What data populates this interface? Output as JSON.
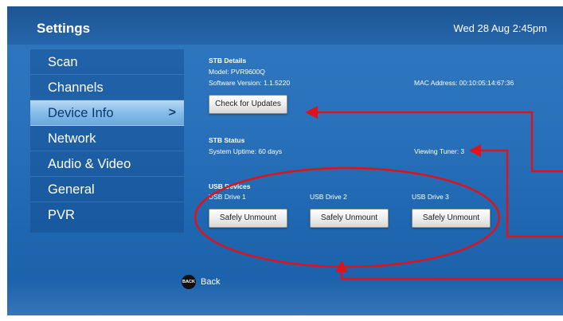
{
  "header": {
    "title": "Settings",
    "datetime": "Wed 28 Aug 2:45pm"
  },
  "menu": {
    "items": [
      {
        "label": "Scan"
      },
      {
        "label": "Channels"
      },
      {
        "label": "Device Info",
        "selected": true
      },
      {
        "label": "Network"
      },
      {
        "label": "Audio & Video"
      },
      {
        "label": "General"
      },
      {
        "label": "PVR"
      }
    ],
    "chevron": ">"
  },
  "stb_details": {
    "heading": "STB Details",
    "model": "Model: PVR9600Q",
    "software_version": "Software Version: 1.1.5220",
    "mac_address": "MAC Address: 00:10:05:14:67:36",
    "check_updates_label": "Check for Updates"
  },
  "stb_status": {
    "heading": "STB Status",
    "uptime": "System Uptime: 60 days",
    "viewing_tuner": "Viewing Tuner: 3"
  },
  "usb_devices": {
    "heading": "USB Devices",
    "drives": [
      {
        "name": "USB Drive 1",
        "button": "Safely Unmount"
      },
      {
        "name": "USB Drive 2",
        "button": "Safely Unmount"
      },
      {
        "name": "USB Drive 3",
        "button": "Safely Unmount"
      }
    ]
  },
  "footer": {
    "back_icon_text": "BACK",
    "back_label": "Back"
  },
  "colors": {
    "annotation": "#e0121a",
    "screen_bg": "#2a72bb",
    "selected_item": "#86bce9"
  }
}
